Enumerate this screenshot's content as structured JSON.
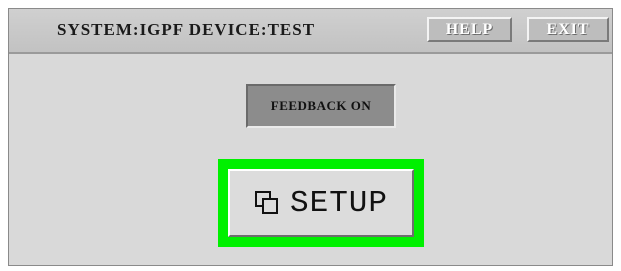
{
  "titlebar": {
    "title": "SYSTEM:IGPF DEVICE:TEST",
    "help_label": "HELP",
    "exit_label": "EXIT"
  },
  "main": {
    "feedback_label": "FEEDBACK ON",
    "setup_label": "SETUP",
    "setup_icon": "windows-stack-icon"
  },
  "colors": {
    "background": "#d9d9d9",
    "titlebar": "#c8c8c8",
    "feedback_button": "#8c8c8c",
    "focus_outline": "#00f000"
  }
}
